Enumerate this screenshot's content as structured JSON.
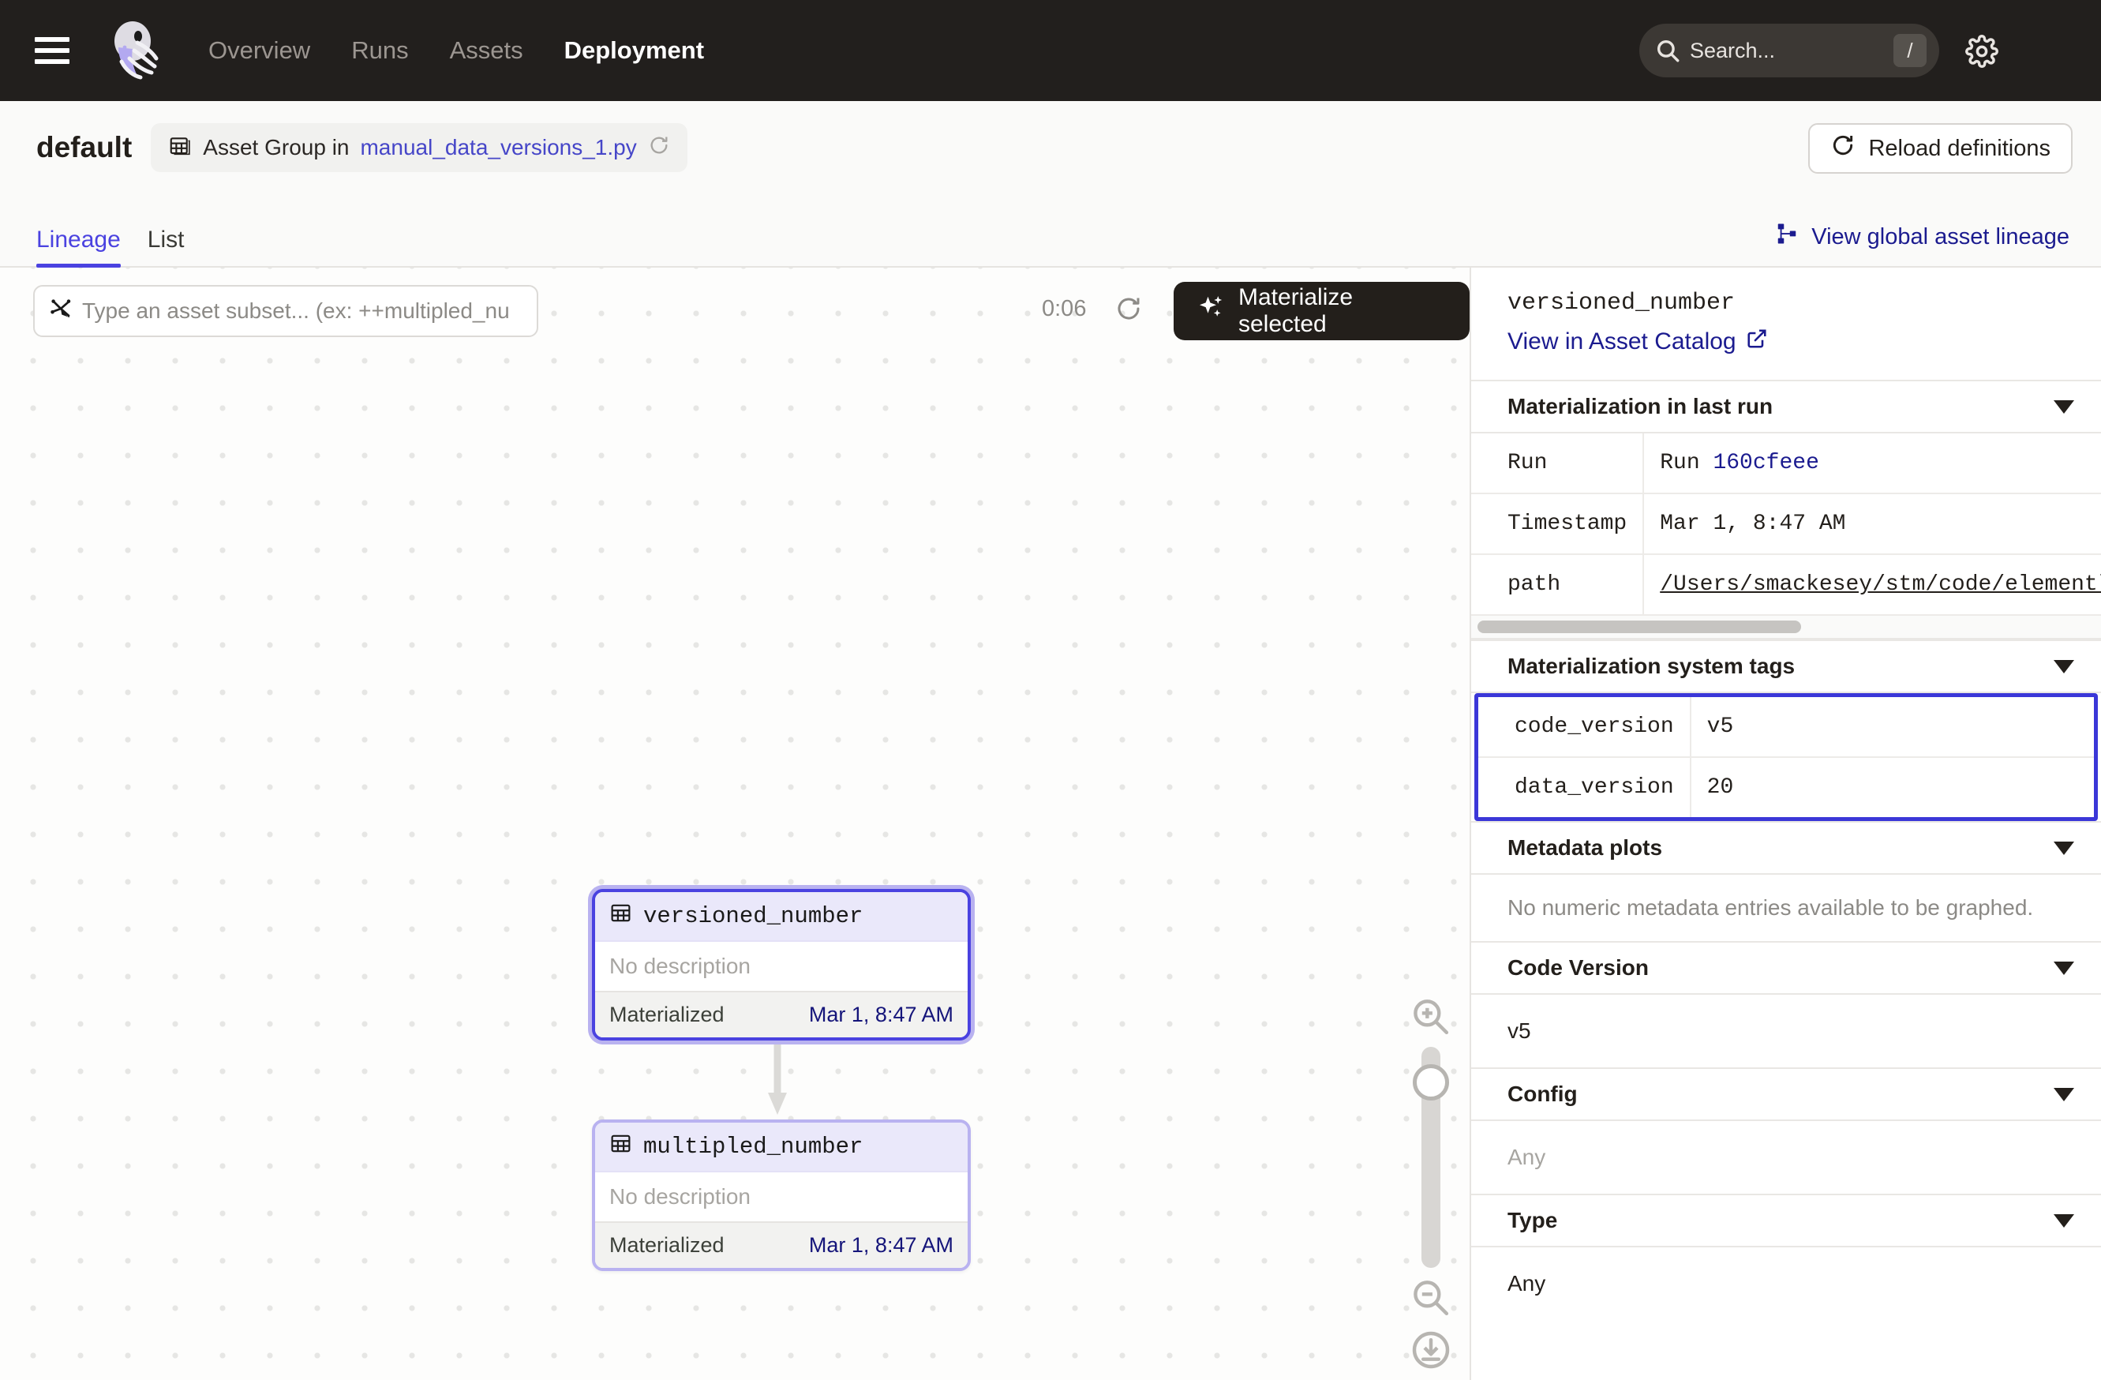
{
  "topnav": {
    "menu_icon": "hamburger-icon",
    "logo": "dagster-logo",
    "links": [
      {
        "label": "Overview",
        "active": false
      },
      {
        "label": "Runs",
        "active": false
      },
      {
        "label": "Assets",
        "active": false
      },
      {
        "label": "Deployment",
        "active": true
      }
    ],
    "search": {
      "placeholder": "Search...",
      "shortcut": "/",
      "icon": "search-icon"
    },
    "settings_icon": "gear-icon"
  },
  "header": {
    "title": "default",
    "breadcrumb_prefix": "Asset Group in",
    "breadcrumb_file": "manual_data_versions_1.py",
    "breadcrumb_icon": "asset-group-icon",
    "breadcrumb_reload_icon": "refresh-icon",
    "reload_button": "Reload definitions",
    "reload_button_icon": "refresh-icon"
  },
  "tabs": {
    "items": [
      {
        "label": "Lineage",
        "active": true
      },
      {
        "label": "List",
        "active": false
      }
    ],
    "global_lineage_link": "View global asset lineage",
    "global_lineage_icon": "lineage-graph-icon"
  },
  "graph": {
    "subset_input": {
      "placeholder": "Type an asset subset... (ex: ++multipled_nu",
      "value": "",
      "icon": "asset-selection-icon"
    },
    "timer": "0:06",
    "refresh_icon": "refresh-icon",
    "materialize_button": "Materialize selected",
    "materialize_icon": "sparkle-icon",
    "nodes": [
      {
        "name": "versioned_number",
        "description": "No description",
        "status_label": "Materialized",
        "timestamp": "Mar 1, 8:47 AM",
        "selected": true,
        "icon": "table-icon"
      },
      {
        "name": "multipled_number",
        "description": "No description",
        "status_label": "Materialized",
        "timestamp": "Mar 1, 8:47 AM",
        "selected": false,
        "icon": "table-icon"
      }
    ],
    "zoom_controls": {
      "zoom_in_icon": "zoom-in-icon",
      "zoom_out_icon": "zoom-out-icon",
      "download_icon": "download-icon",
      "slider": "zoom-slider"
    }
  },
  "panel": {
    "asset_name": "versioned_number",
    "catalog_link": "View in Asset Catalog",
    "catalog_link_icon": "external-link-icon",
    "materialization_section": {
      "title": "Materialization in last run",
      "rows": [
        {
          "key": "Run",
          "value_prefix": "Run ",
          "value": "160cfeee",
          "is_link": true
        },
        {
          "key": "Timestamp",
          "value_prefix": "",
          "value": "Mar 1, 8:47 AM",
          "is_link": false
        },
        {
          "key": "path",
          "value_prefix": "",
          "value": "/Users/smackesey/stm/code/elementl/",
          "is_link": false,
          "underline": true
        }
      ]
    },
    "system_tags_section": {
      "title": "Materialization system tags",
      "highlight_color": "#3B37D8",
      "rows": [
        {
          "key": "code_version",
          "value": "v5"
        },
        {
          "key": "data_version",
          "value": "20"
        }
      ]
    },
    "metadata_plots_section": {
      "title": "Metadata plots",
      "body": "No numeric metadata entries available to be graphed."
    },
    "code_version_section": {
      "title": "Code Version",
      "body": "v5"
    },
    "config_section": {
      "title": "Config",
      "body": "Any"
    },
    "type_section": {
      "title": "Type",
      "body": "Any"
    }
  }
}
